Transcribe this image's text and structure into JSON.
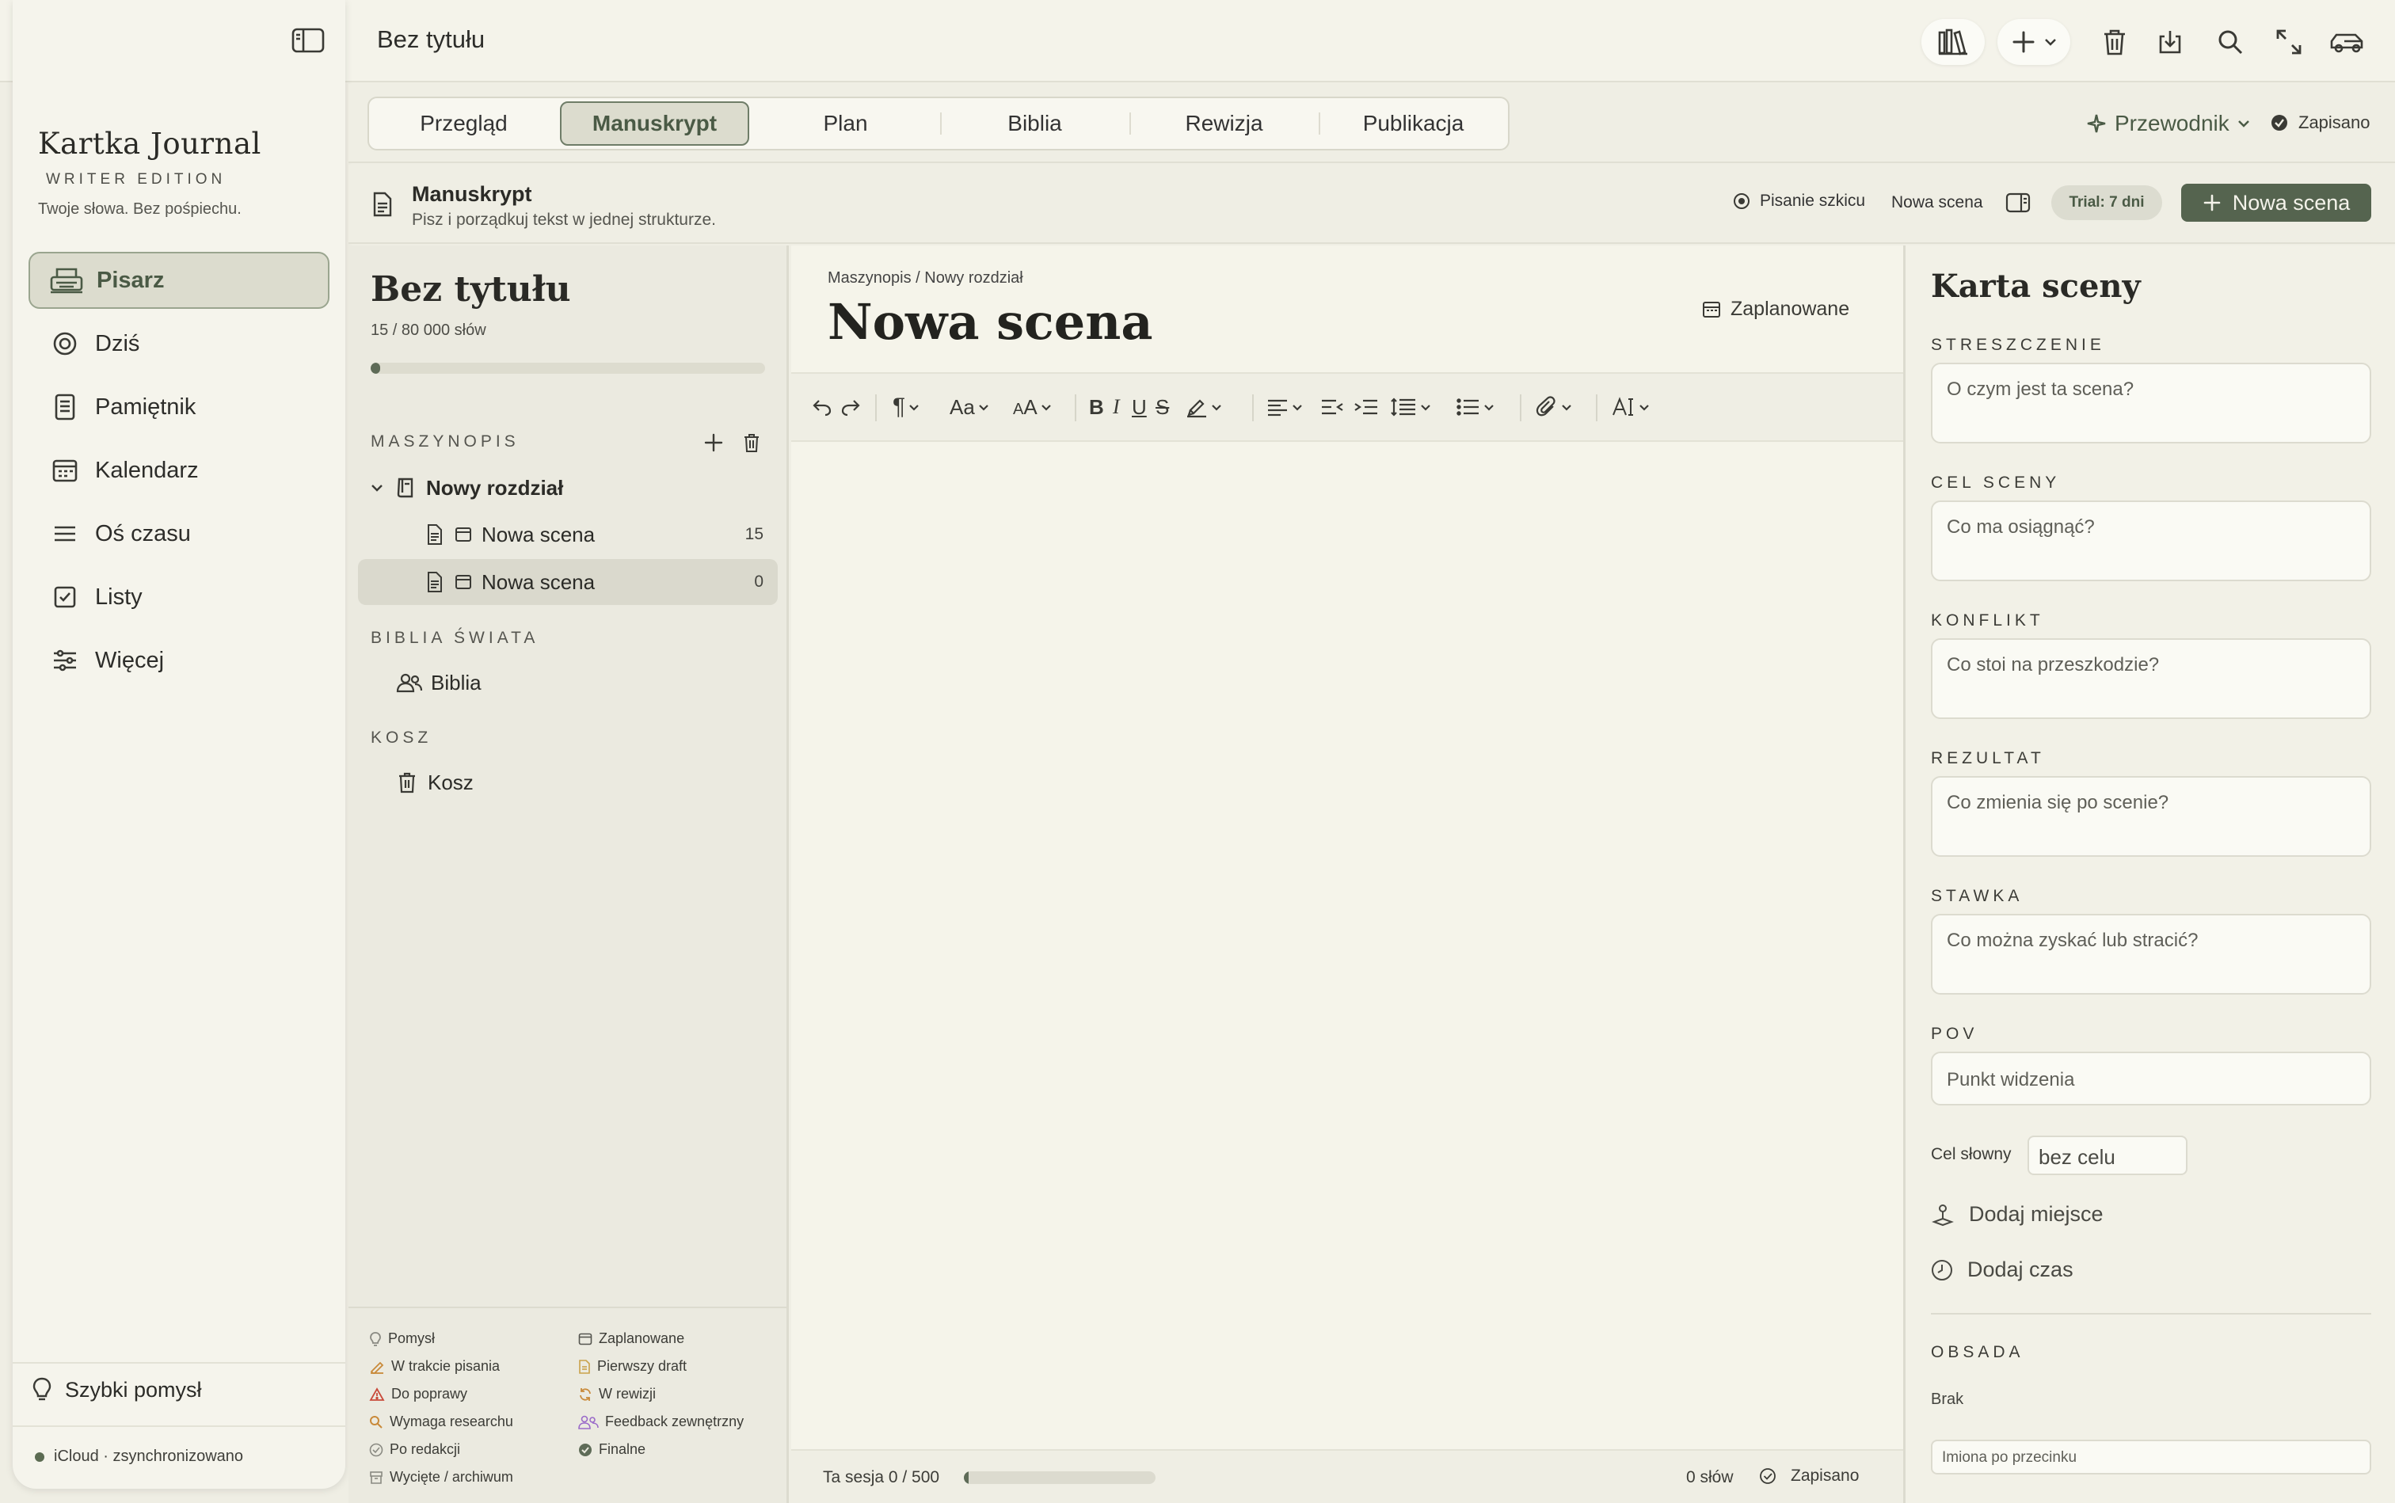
{
  "topbar": {
    "doc_title": "Bez tytułu",
    "icons": [
      "sidebar-toggle-icon",
      "library-icon",
      "plus-icon",
      "chevron-down-icon",
      "trash-icon",
      "export-icon",
      "search-icon",
      "fullscreen-icon",
      "focus-mode-icon"
    ]
  },
  "sidebar": {
    "brand_name": "Kartka Journal",
    "brand_edition": "WRITER EDITION",
    "tagline": "Twoje słowa. Bez pośpiechu.",
    "items": [
      {
        "label": "Pisarz",
        "icon": "typewriter-icon",
        "active": true
      },
      {
        "label": "Dziś",
        "icon": "target-icon",
        "active": false
      },
      {
        "label": "Pamiętnik",
        "icon": "journal-icon",
        "active": false
      },
      {
        "label": "Kalendarz",
        "icon": "calendar-icon",
        "active": false
      },
      {
        "label": "Oś czasu",
        "icon": "timeline-icon",
        "active": false
      },
      {
        "label": "Listy",
        "icon": "checklist-icon",
        "active": false
      },
      {
        "label": "Więcej",
        "icon": "sliders-icon",
        "active": false
      }
    ],
    "quick_idea": "Szybki pomysł",
    "sync_status": "iCloud · zsynchronizowano"
  },
  "tabs": {
    "items": [
      "Przegląd",
      "Manuskrypt",
      "Plan",
      "Biblia",
      "Rewizja",
      "Publikacja"
    ],
    "active": "Manuskrypt",
    "guide_label": "Przewodnik",
    "saved_label": "Zapisano"
  },
  "section": {
    "title": "Manuskrypt",
    "subtitle": "Pisz i porządkuj tekst w jednej strukturze.",
    "draft_status": "Pisanie szkicu",
    "new_scene_link": "Nowa scena",
    "trial": "Trial: 7 dni",
    "new_scene_button": "Nowa scena"
  },
  "tree": {
    "project_title": "Bez tytułu",
    "word_progress": "15 / 80 000 słów",
    "word_progress_fraction": 0.0002,
    "manuscript_label": "MASZYNOPIS",
    "chapter": "Nowy rozdział",
    "scenes": [
      {
        "label": "Nowa scena",
        "count": "15",
        "active": false
      },
      {
        "label": "Nowa scena",
        "count": "0",
        "active": true
      }
    ],
    "bible_label": "BIBLIA ŚWIATA",
    "bible_item": "Biblia",
    "trash_label": "KOSZ",
    "trash_item": "Kosz",
    "legend": [
      {
        "label": "Pomysł",
        "icon": "bulb-icon",
        "color": "#8a8a82"
      },
      {
        "label": "Zaplanowane",
        "icon": "calendar-icon",
        "color": "#55554f"
      },
      {
        "label": "W trakcie pisania",
        "icon": "pencil-icon",
        "color": "#c98a3a"
      },
      {
        "label": "Pierwszy draft",
        "icon": "document-icon",
        "color": "#c9a24a"
      },
      {
        "label": "Do poprawy",
        "icon": "warning-icon",
        "color": "#c94a3a"
      },
      {
        "label": "W rewizji",
        "icon": "refresh-icon",
        "color": "#c98a3a"
      },
      {
        "label": "Wymaga researchu",
        "icon": "search-icon",
        "color": "#c98a3a"
      },
      {
        "label": "Feedback zewnętrzny",
        "icon": "people-icon",
        "color": "#9a6ac9"
      },
      {
        "label": "Po redakcji",
        "icon": "check-circle-icon",
        "color": "#8a8a82"
      },
      {
        "label": "Finalne",
        "icon": "check-filled-icon",
        "color": "#5e6b57"
      },
      {
        "label": "Wycięte / archiwum",
        "icon": "archive-icon",
        "color": "#8a8a82"
      }
    ]
  },
  "editor": {
    "breadcrumb": "Maszynopis / Nowy rozdział",
    "scene_title": "Nowa scena",
    "scene_status": "Zaplanowane",
    "footer": {
      "session": "Ta sesja 0 / 500",
      "session_fraction": 0.008,
      "words": "0 słów",
      "saved": "Zapisano"
    }
  },
  "scene_card": {
    "title": "Karta sceny",
    "fields": [
      {
        "label": "STRESZCZENIE",
        "placeholder": "O czym jest ta scena?"
      },
      {
        "label": "CEL SCENY",
        "placeholder": "Co ma osiągnąć?"
      },
      {
        "label": "KONFLIKT",
        "placeholder": "Co stoi na przeszkodzie?"
      },
      {
        "label": "REZULTAT",
        "placeholder": "Co zmienia się po scenie?"
      },
      {
        "label": "STAWKA",
        "placeholder": "Co można zyskać lub stracić?"
      }
    ],
    "pov_label": "POV",
    "pov_placeholder": "Punkt widzenia",
    "word_goal_label": "Cel słowny",
    "word_goal_placeholder": "bez celu",
    "add_place": "Dodaj miejsce",
    "add_time": "Dodaj czas",
    "cast_label": "OBSADA",
    "cast_none": "Brak",
    "cast_placeholder": "Imiona po przecinku"
  },
  "colors": {
    "accent": "#55644f",
    "background": "#efeee4",
    "sidebar": "#f5f4ec"
  }
}
